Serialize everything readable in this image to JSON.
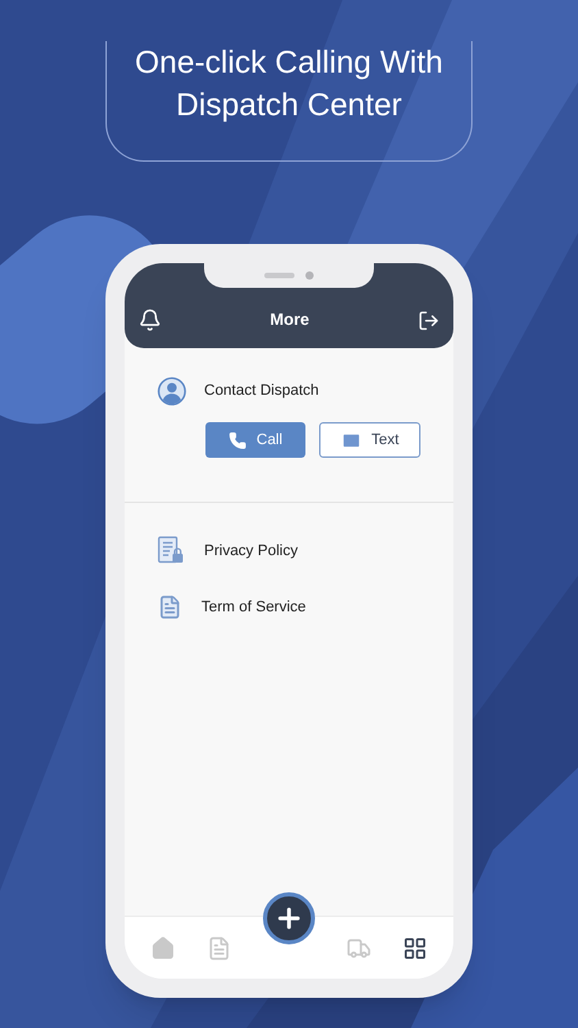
{
  "headline": "One-click Calling With Dispatch Center",
  "header": {
    "title": "More"
  },
  "contact": {
    "label": "Contact Dispatch",
    "buttons": [
      {
        "kind": "call",
        "label": "Call"
      },
      {
        "kind": "text",
        "label": "Text"
      }
    ]
  },
  "links": [
    {
      "kind": "privacy",
      "label": "Privacy Policy"
    },
    {
      "kind": "terms",
      "label": "Term of Service"
    }
  ],
  "nav": [
    {
      "kind": "home",
      "selected": false
    },
    {
      "kind": "document",
      "selected": false
    },
    {
      "kind": "add",
      "selected": false
    },
    {
      "kind": "truck",
      "selected": false
    },
    {
      "kind": "grid",
      "selected": true
    }
  ]
}
